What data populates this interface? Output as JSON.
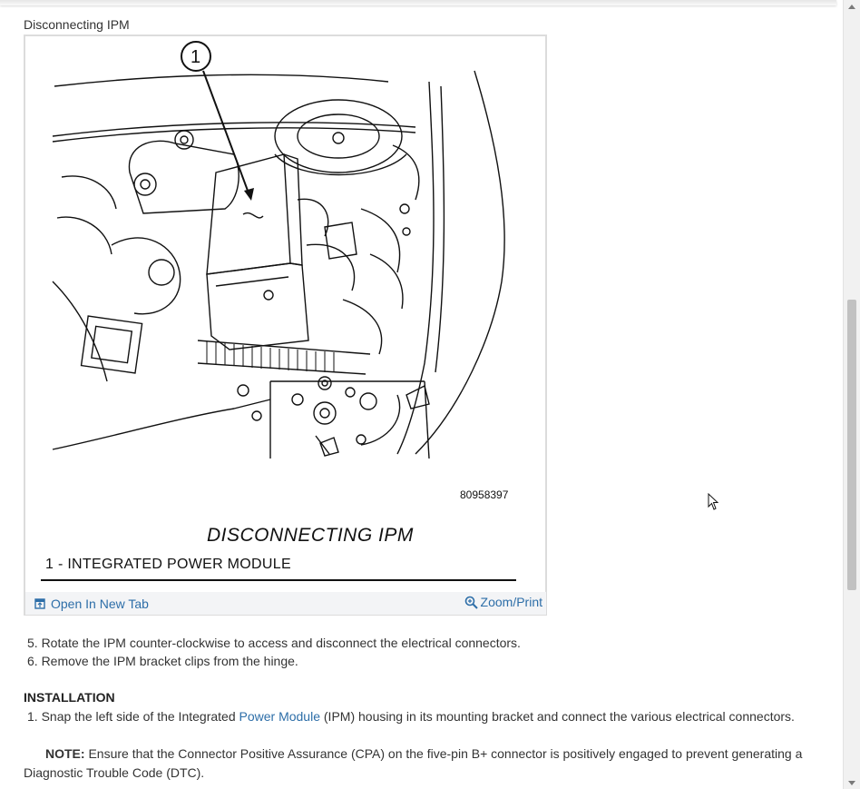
{
  "figure": {
    "caption": "Disconnecting IPM",
    "callout_number": "1",
    "image_number": "80958397",
    "title": "DISCONNECTING IPM",
    "legend": "1 - INTEGRATED POWER MODULE",
    "open_tab_label": "Open In New Tab",
    "zoom_label": "Zoom/Print"
  },
  "removal_steps": [
    "5. Rotate the IPM counter-clockwise to access and disconnect the electrical connectors.",
    "6. Remove the IPM bracket clips from the hinge."
  ],
  "installation": {
    "heading": "INSTALLATION",
    "step1_prefix": "1. Snap the left side of the Integrated ",
    "step1_link": "Power Module",
    "step1_suffix": " (IPM) housing in its mounting bracket and connect the various electrical connectors.",
    "note_label": "NOTE:",
    "note_text": " Ensure that the Connector Positive Assurance (CPA) on the five-pin B+ connector is positively engaged to prevent generating a Diagnostic Trouble Code (DTC)."
  },
  "icons": {
    "open_tab": "open-new-tab-icon",
    "zoom": "magnifier-icon",
    "cursor": "mouse-pointer-icon"
  },
  "colors": {
    "link": "#2d6ea8"
  }
}
